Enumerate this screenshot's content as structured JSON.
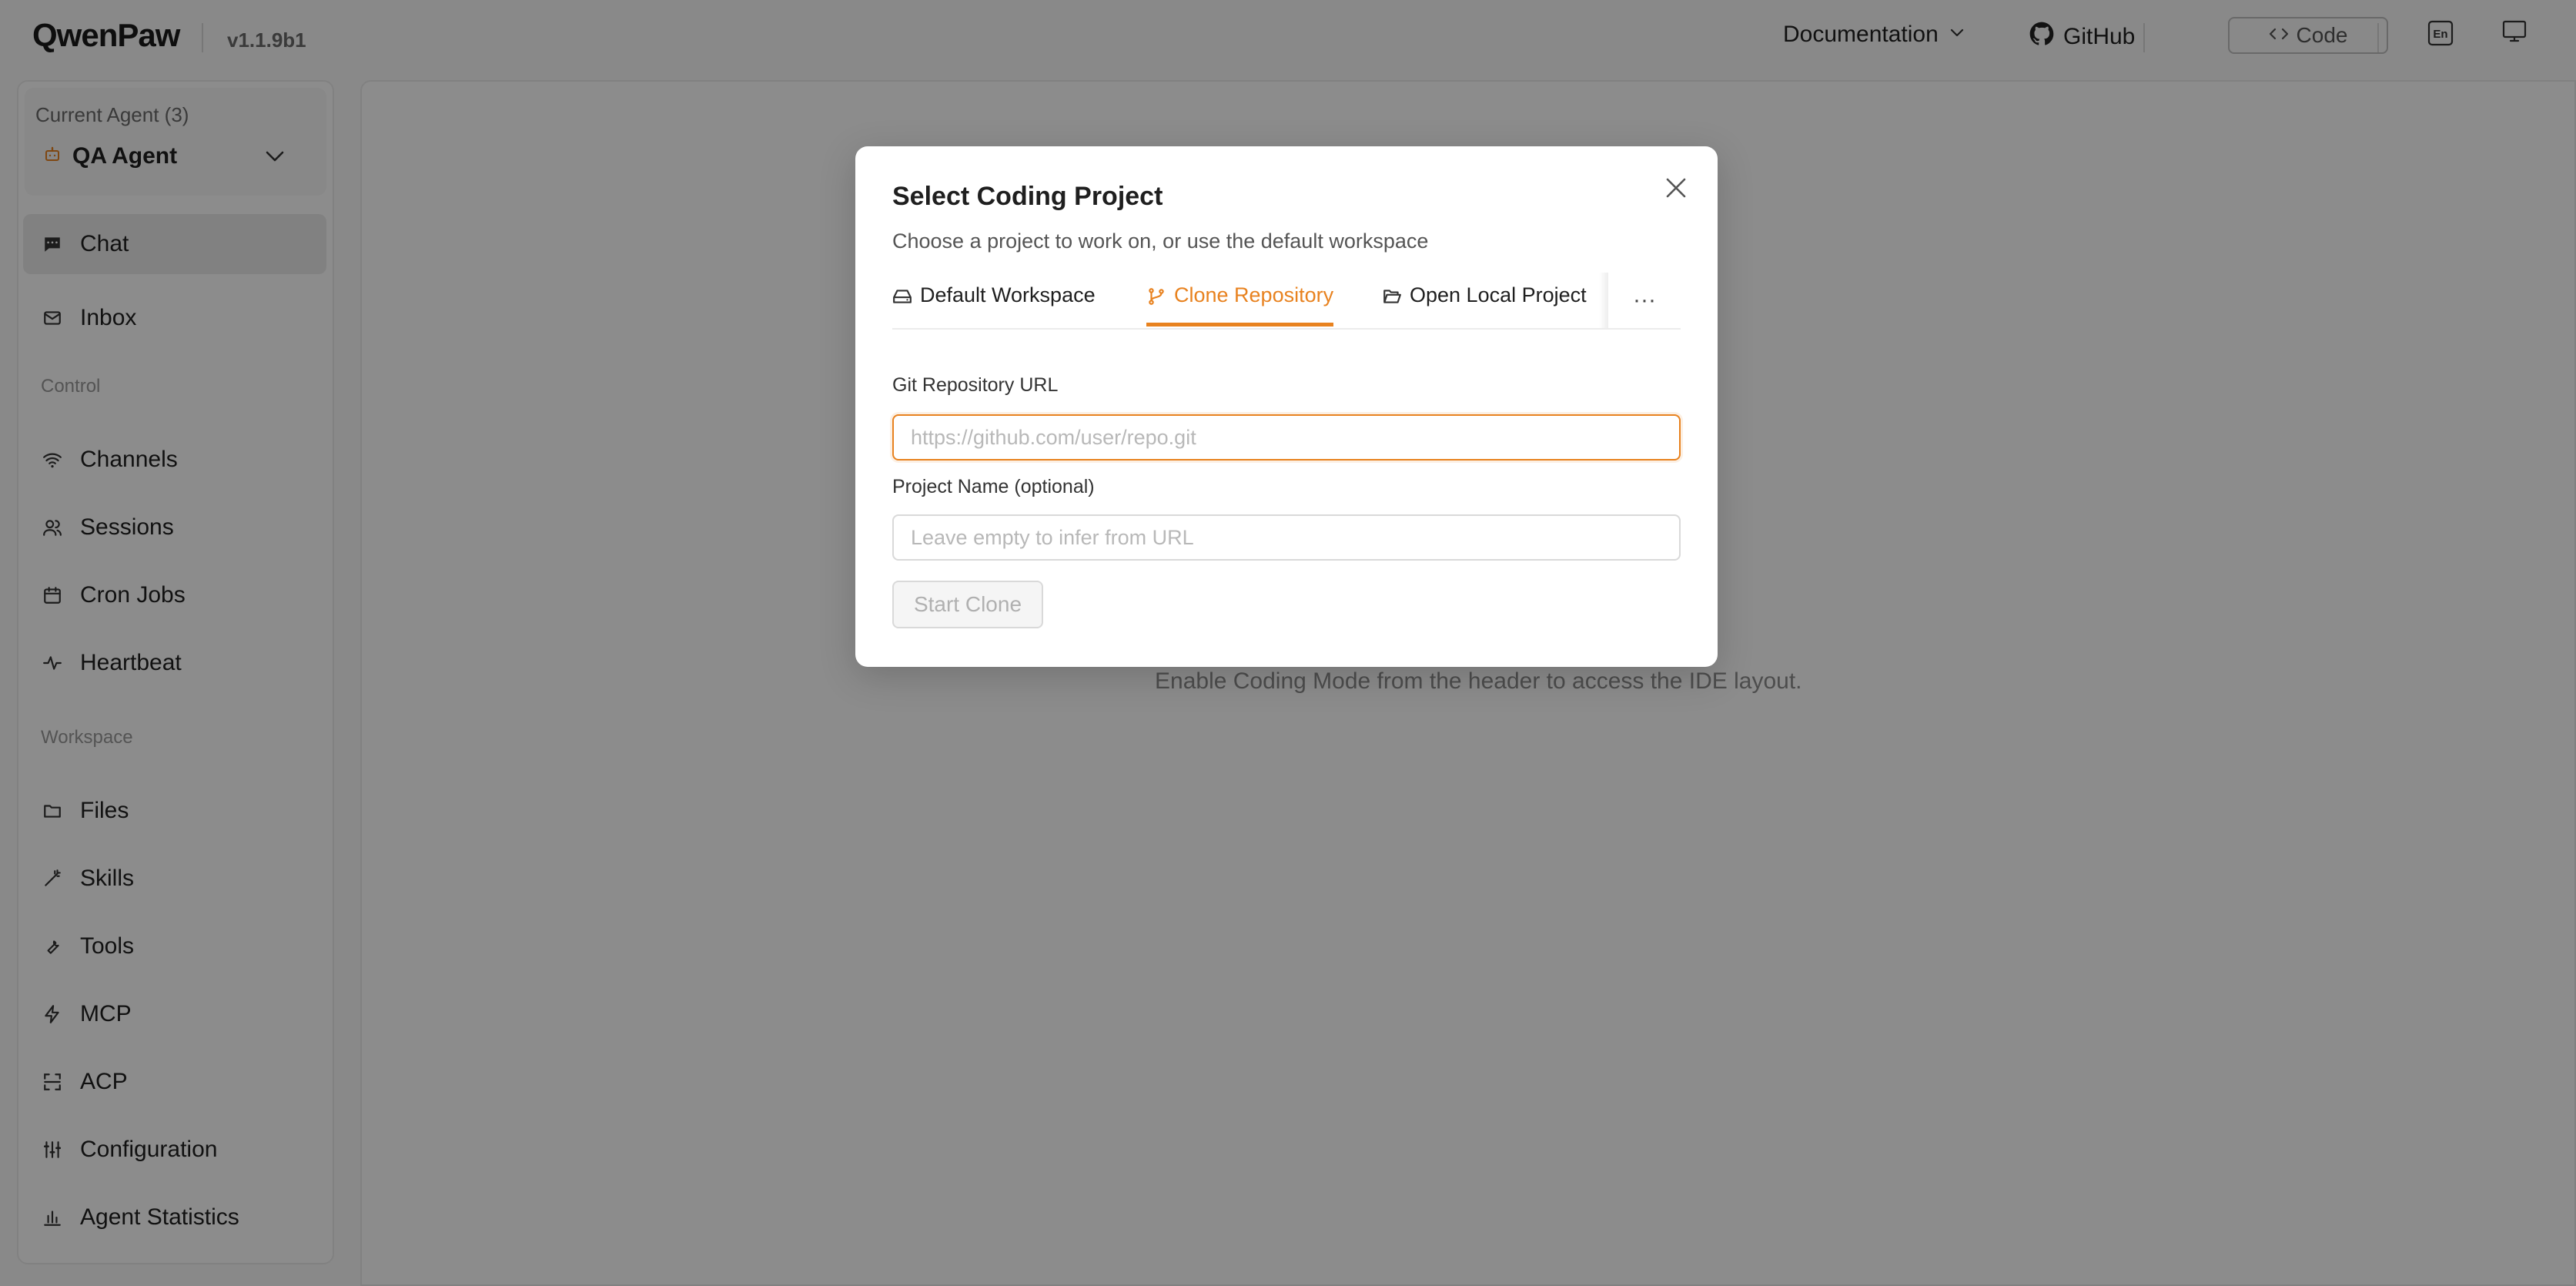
{
  "header": {
    "logo": "QwenPaw",
    "version": "v1.1.9b1",
    "documentation": "Documentation",
    "github": "GitHub",
    "code": "Code",
    "language": "En"
  },
  "sidebar": {
    "agent_caption": "Current Agent (3)",
    "agent_name": "QA Agent",
    "items_top": [
      {
        "label": "Chat",
        "icon": "chat-icon",
        "active": true
      },
      {
        "label": "Inbox",
        "icon": "mail-icon"
      }
    ],
    "section_control": "Control",
    "items_control": [
      {
        "label": "Channels",
        "icon": "wifi-icon"
      },
      {
        "label": "Sessions",
        "icon": "users-icon"
      },
      {
        "label": "Cron Jobs",
        "icon": "calendar-icon"
      },
      {
        "label": "Heartbeat",
        "icon": "pulse-icon"
      }
    ],
    "section_workspace": "Workspace",
    "items_workspace": [
      {
        "label": "Files",
        "icon": "folder-icon"
      },
      {
        "label": "Skills",
        "icon": "wand-icon"
      },
      {
        "label": "Tools",
        "icon": "wrench-icon"
      },
      {
        "label": "MCP",
        "icon": "bolt-icon"
      },
      {
        "label": "ACP",
        "icon": "scan-icon"
      },
      {
        "label": "Configuration",
        "icon": "sliders-icon"
      },
      {
        "label": "Agent Statistics",
        "icon": "bar-chart-icon"
      }
    ]
  },
  "main": {
    "hint": "Enable Coding Mode from the header to access the IDE layout."
  },
  "modal": {
    "title": "Select Coding Project",
    "subtitle": "Choose a project to work on, or use the default workspace",
    "tabs": [
      {
        "label": "Default Workspace",
        "icon": "drive-icon"
      },
      {
        "label": "Clone Repository",
        "icon": "git-branch-icon",
        "active": true
      },
      {
        "label": "Open Local Project",
        "icon": "folder-open-icon"
      }
    ],
    "more": "···",
    "git_url_label": "Git Repository URL",
    "git_url_placeholder": "https://github.com/user/repo.git",
    "git_url_value": "",
    "project_name_label": "Project Name (optional)",
    "project_name_placeholder": "Leave empty to infer from URL",
    "project_name_value": "",
    "start_button": "Start Clone"
  },
  "colors": {
    "accent": "#e8821f",
    "overlay": "rgba(0,0,0,0.45)"
  }
}
